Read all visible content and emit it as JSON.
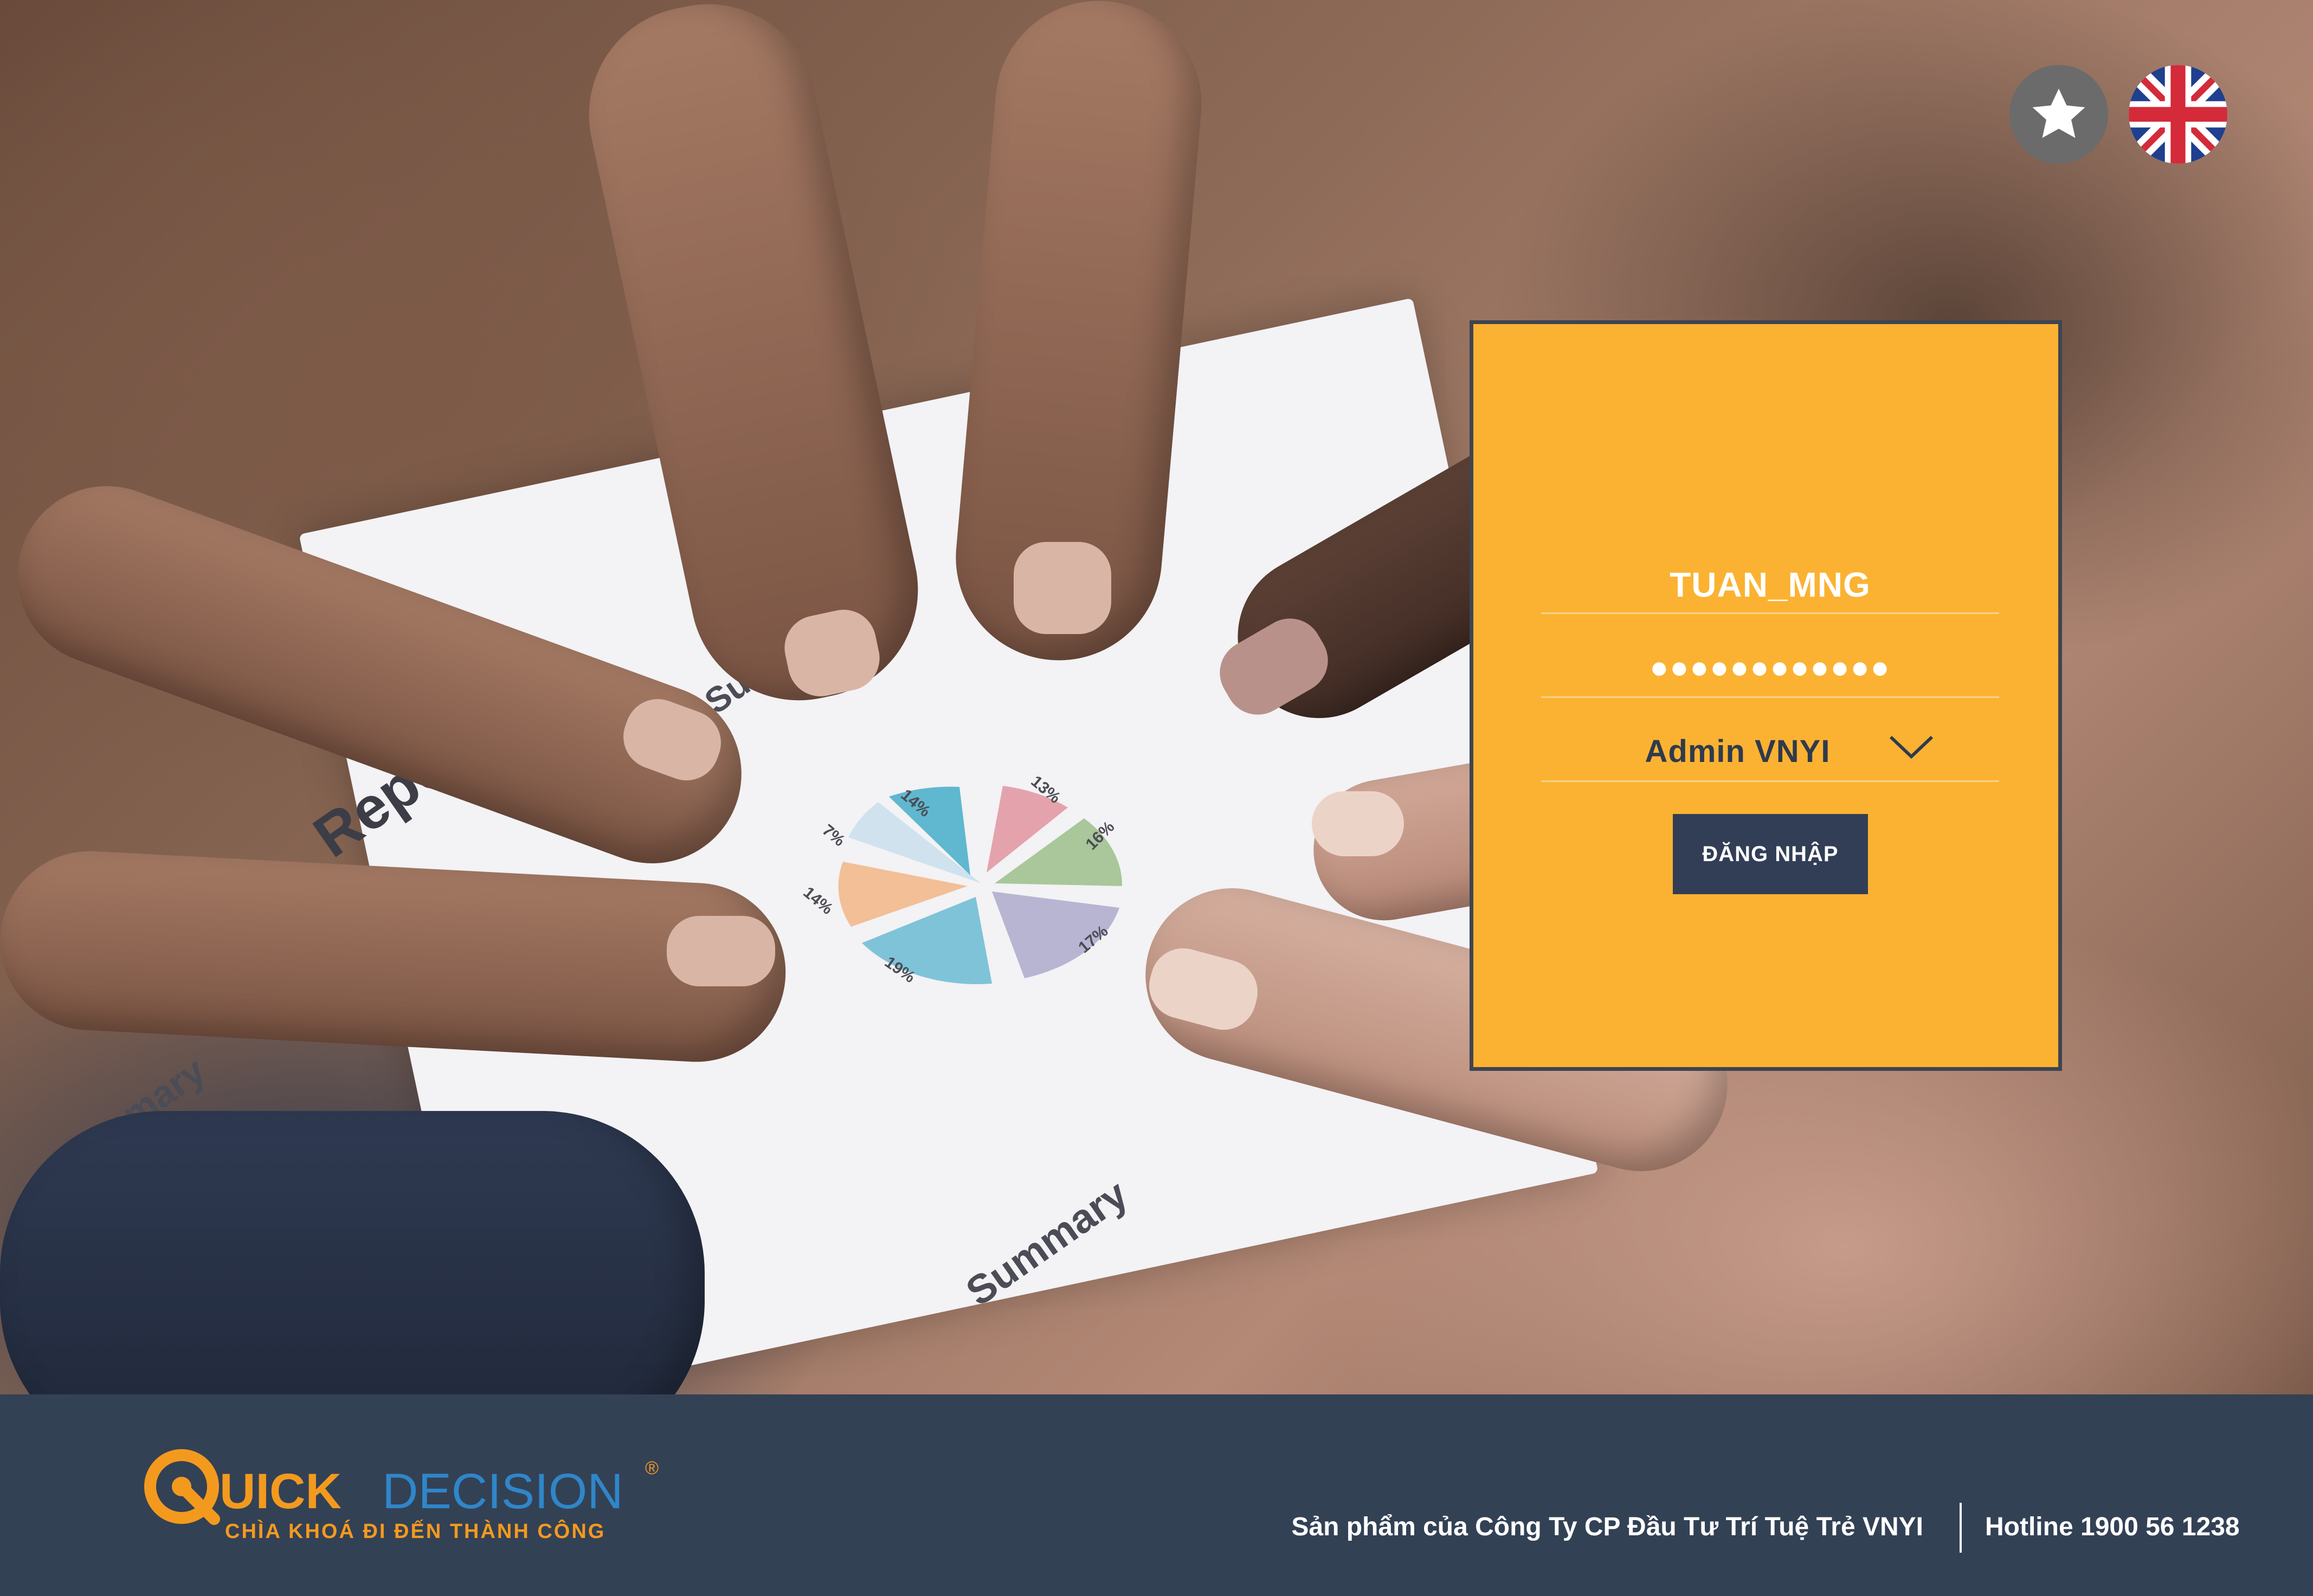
{
  "background": {
    "photo_text": [
      "Report",
      "Summary",
      "Summary",
      "Su"
    ],
    "pie_labels": [
      "14%",
      "7%",
      "13%",
      "16%",
      "14%",
      "19%",
      "17%"
    ]
  },
  "language": {
    "star_icon": "star-icon",
    "flag_icon": "uk-flag-icon"
  },
  "login": {
    "username": "TUAN_MNG",
    "password_mask": "●●●●●●●●●●●●",
    "role_selected": "Admin VNYI",
    "login_button": "ĐĂNG NHẬP",
    "colors": {
      "card": "#fbb232",
      "button": "#323e56",
      "border": "#3e4450"
    }
  },
  "footer": {
    "logo_main_1": "UICK",
    "logo_main_2": "DECISION",
    "logo_registered": "®",
    "logo_tagline": "CHÌA KHOÁ ĐI ĐẾN THÀNH CÔNG",
    "company": "Sản phẩm của Công Ty CP Đầu Tư Trí Tuệ Trẻ VNYI",
    "hotline": "Hotline 1900 56 1238",
    "colors": {
      "background": "#334155",
      "logo_orange": "#f39a1e",
      "logo_blue": "#2f86c9"
    }
  }
}
